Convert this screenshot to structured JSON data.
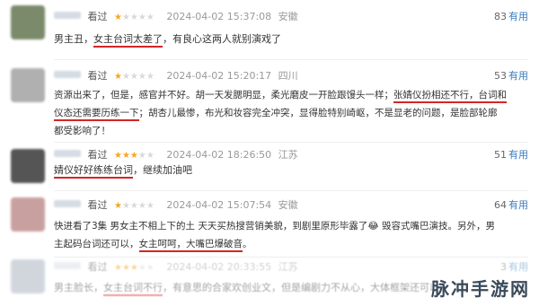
{
  "reviews": [
    {
      "seen_label": "看过",
      "rating_filled": 1,
      "rating_max": 5,
      "date": "2024-04-02 15:37:08",
      "location": "安徽",
      "useful_count": "83",
      "useful_label": "有用",
      "segments": [
        "男主丑，",
        "女主台词太差了",
        "，有良心这两人就别演戏了"
      ],
      "avatar_color": "#7a8a6a"
    },
    {
      "seen_label": "看过",
      "rating_filled": 1,
      "rating_max": 5,
      "date": "2024-04-02 15:20:17",
      "location": "四川",
      "useful_count": "53",
      "useful_label": "有用",
      "line1": [
        "资源出来了，但是，感官并不好。胡一天发腮明显，柔光磨皮一开脸跟馒头一样；",
        "张婧仪扮相还不行，台词和"
      ],
      "line2": [
        "仪态还需要历练一下",
        "；胡杏儿最惨，布光和妆容完全冲突，显得脸特别崎岖，不是显老的问题，是脸部轮廓"
      ],
      "line3": "都受影响了！",
      "avatar_color": "#b0b0b0"
    },
    {
      "seen_label": "看过",
      "rating_filled": 3,
      "rating_max": 5,
      "date": "2024-04-02 18:26:50",
      "location": "江苏",
      "useful_count": "51",
      "useful_label": "有用",
      "segments": [
        "婧仪好好练练台词",
        "，继续加油吧"
      ],
      "avatar_color": "#555555"
    },
    {
      "seen_label": "看过",
      "rating_filled": 1,
      "rating_max": 5,
      "date": "2024-04-02 15:07:54",
      "location": "安徽",
      "useful_count": "64",
      "useful_label": "有用",
      "line1": "快进看了3集 男女主不相上下的土 天天买热搜营销美貌，到剧里原形毕露了😂 毁容式嘴巴演技。另外，男",
      "line2": [
        "主起码台词还可以，",
        "女主呵呵，大嘴巴爆破音",
        "。"
      ],
      "avatar_color": "#c9a0a0"
    },
    {
      "seen_label": "看过",
      "rating_filled": 3,
      "rating_max": 5,
      "date": "2024-04-02 20:33:55",
      "location": "江苏",
      "useful_count": "3",
      "useful_label": "有用",
      "segments": [
        "男主脸长，",
        "女主台词不行",
        "，有意思的合家欢创业文，但是编剧力不从心，大体框架还可以"
      ],
      "avatar_color": "#9aa6b6"
    }
  ],
  "watermark": "脉冲手游网"
}
